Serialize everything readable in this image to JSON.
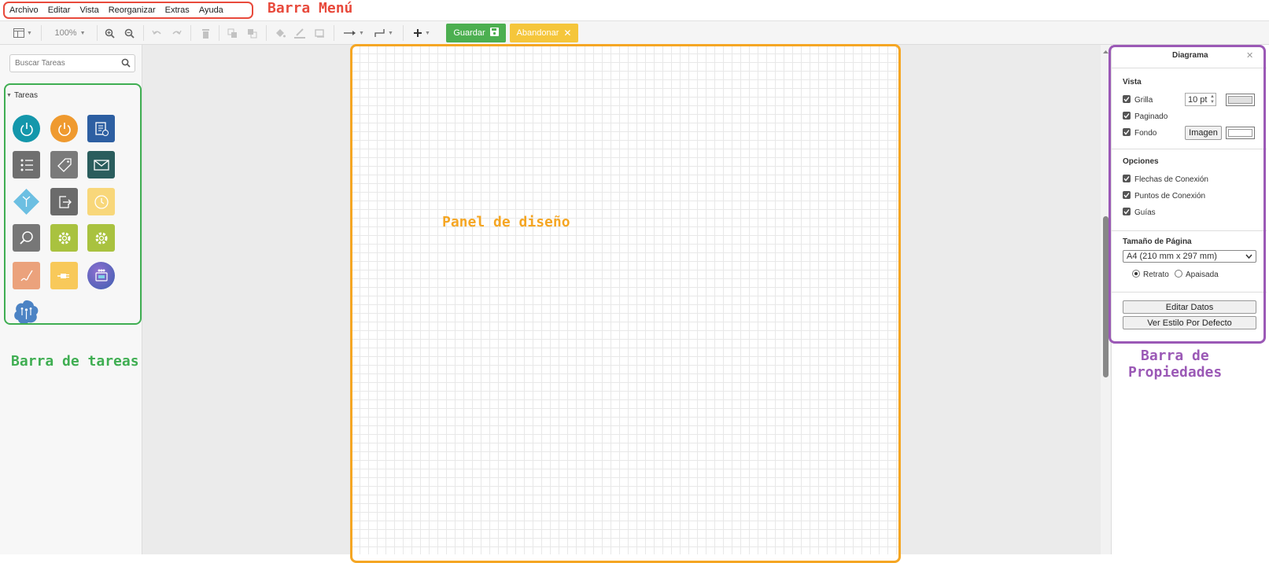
{
  "menu": {
    "items": [
      "Archivo",
      "Editar",
      "Vista",
      "Reorganizar",
      "Extras",
      "Ayuda"
    ]
  },
  "annotations": {
    "menu": "Barra Menú",
    "tasks": "Barra de tareas",
    "design": "Panel de diseño",
    "props_line1": "Barra de",
    "props_line2": "Propiedades"
  },
  "toolbar": {
    "zoom": "100%",
    "save_label": "Guardar",
    "discard_label": "Abandonar"
  },
  "sidebar": {
    "search_placeholder": "Buscar Tareas",
    "section_title": "Tareas",
    "icons": [
      {
        "name": "start-event-icon",
        "color": "#1497ab"
      },
      {
        "name": "end-event-icon",
        "color": "#ef9a2f"
      },
      {
        "name": "document-task-icon",
        "color": "#2d5fa2"
      },
      {
        "name": "list-task-icon",
        "color": "#6f6f6f"
      },
      {
        "name": "tag-task-icon",
        "color": "#7a7a7a"
      },
      {
        "name": "email-task-icon",
        "color": "#2a5d5d"
      },
      {
        "name": "gateway-icon",
        "color": "#6cbfe2"
      },
      {
        "name": "exit-task-icon",
        "color": "#6b6b6b"
      },
      {
        "name": "timer-task-icon",
        "color": "#f8d77a"
      },
      {
        "name": "search-task-icon",
        "color": "#777777"
      },
      {
        "name": "service-task-icon",
        "color": "#a9c23f"
      },
      {
        "name": "service-task-2-icon",
        "color": "#a9c23f"
      },
      {
        "name": "signature-task-icon",
        "color": "#eba27c"
      },
      {
        "name": "plug-task-icon",
        "color": "#f8c95a"
      },
      {
        "name": "robot-task-icon",
        "color": "#5b6fbf"
      },
      {
        "name": "cloud-task-icon",
        "color": "#4c83c4"
      }
    ]
  },
  "properties": {
    "title": "Diagrama",
    "view_section": "Vista",
    "grid_label": "Grilla",
    "grid_size": "10 pt",
    "paged_label": "Paginado",
    "background_label": "Fondo",
    "image_button": "Imagen",
    "options_section": "Opciones",
    "connection_arrows": "Flechas de Conexión",
    "connection_points": "Puntos de Conexión",
    "guides": "Guías",
    "page_size_section": "Tamaño de Página",
    "page_size_value": "A4 (210 mm x 297 mm)",
    "portrait": "Retrato",
    "landscape": "Apaisada",
    "edit_data_button": "Editar Datos",
    "default_style_button": "Ver Estilo Por Defecto"
  },
  "colors": {
    "menu_annotation": "#e84a3c",
    "tasks_annotation": "#3fae52",
    "design_annotation": "#f5a623",
    "props_annotation": "#9b59b6",
    "save_button": "#4caf50",
    "discard_button": "#f5c63b"
  }
}
